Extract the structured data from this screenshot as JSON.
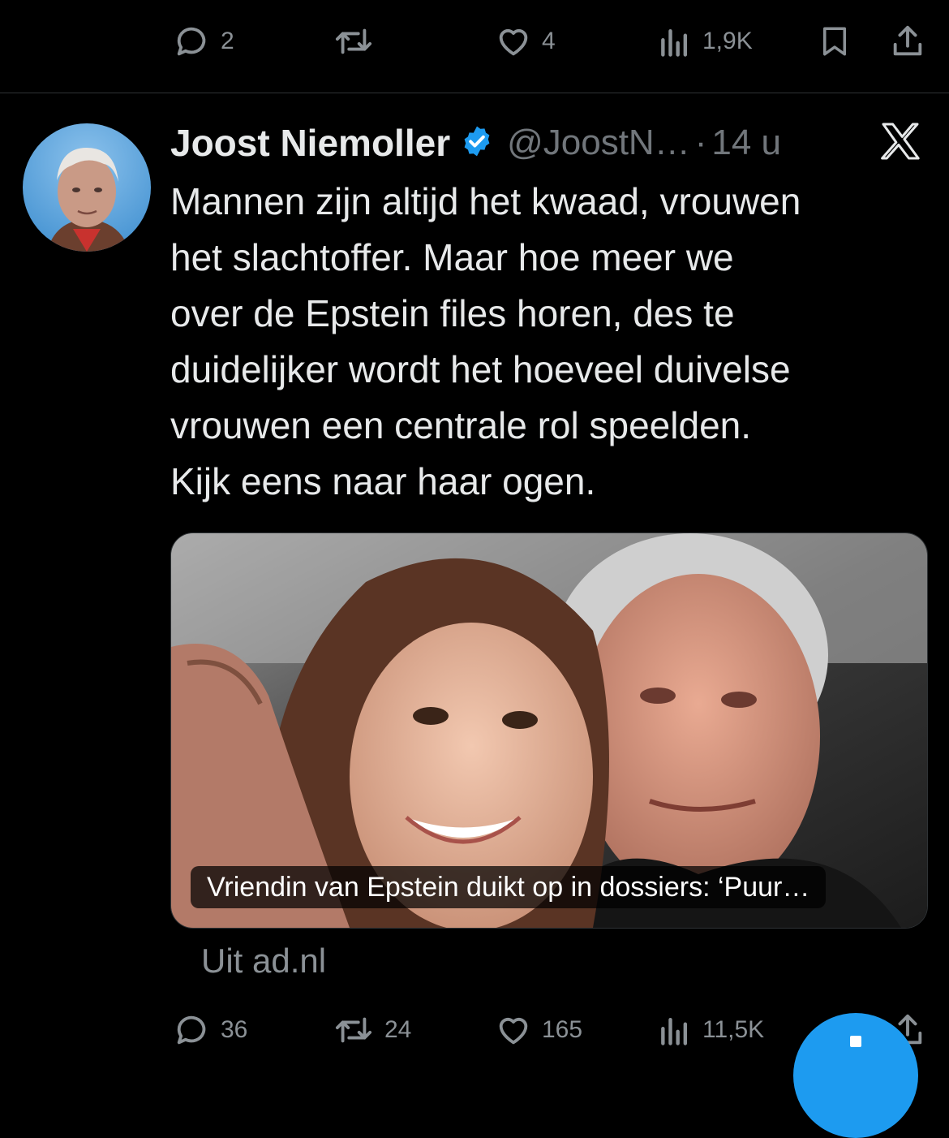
{
  "top_actions": {
    "replies": "2",
    "retweets": "",
    "likes": "4",
    "views": "1,9K"
  },
  "tweet": {
    "author_name": "Joost Niemoller",
    "handle": "@JoostN…",
    "separator": "·",
    "time": "14 u",
    "text": "Mannen zijn altijd het kwaad, vrouwen\nhet slachtoffer. Maar hoe meer we\nover de Epstein files horen, des te\nduidelijker wordt het hoeveel duivelse\nvrouwen een centrale rol speelden.\nKijk eens naar haar ogen.",
    "card_caption": "Vriendin van Epstein duikt op in dossiers: ‘Puur…",
    "card_source": "Uit ad.nl"
  },
  "bottom_actions": {
    "replies": "36",
    "retweets": "24",
    "likes": "165",
    "views": "11,5K"
  },
  "colors": {
    "background": "#000000",
    "text": "#e7e9ea",
    "muted": "#71767b",
    "verified": "#1d9bf0",
    "fab": "#1d9bf0"
  },
  "icons": [
    "reply-icon",
    "retweet-icon",
    "like-icon",
    "views-icon",
    "bookmark-icon",
    "share-icon",
    "verified-badge-icon",
    "x-logo-icon",
    "compose-icon"
  ]
}
